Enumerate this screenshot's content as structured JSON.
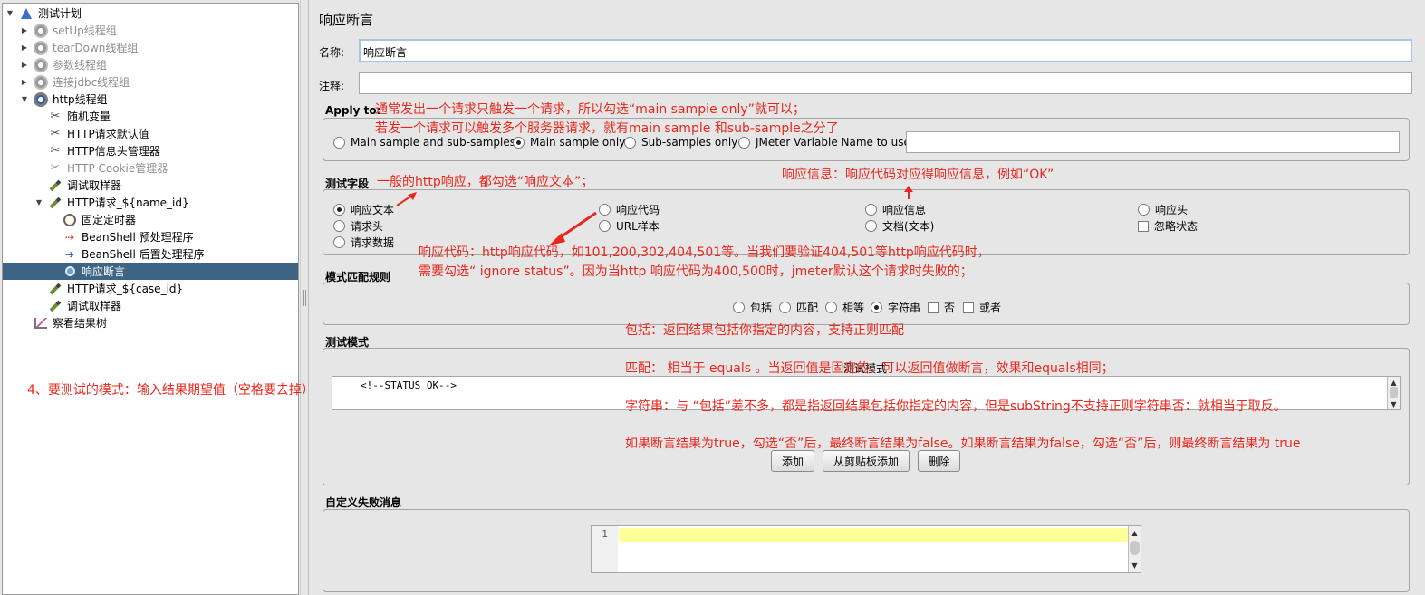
{
  "tree": {
    "items": [
      {
        "label": "测试计划"
      },
      {
        "label": "setUp线程组"
      },
      {
        "label": "tearDown线程组"
      },
      {
        "label": "参数线程组"
      },
      {
        "label": "连接jdbc线程组"
      },
      {
        "label": "http线程组"
      },
      {
        "label": "随机变量"
      },
      {
        "label": "HTTP请求默认值"
      },
      {
        "label": "HTTP信息头管理器"
      },
      {
        "label": "HTTP Cookie管理器"
      },
      {
        "label": "调试取样器"
      },
      {
        "label": "HTTP请求_${name_id}"
      },
      {
        "label": "固定定时器"
      },
      {
        "label": "BeanShell 预处理程序"
      },
      {
        "label": "BeanShell 后置处理程序"
      },
      {
        "label": "响应断言"
      },
      {
        "label": "HTTP请求_${case_id}"
      },
      {
        "label": "调试取样器"
      },
      {
        "label": "察看结果树"
      }
    ]
  },
  "panel": {
    "title": "响应断言",
    "name_label": "名称:",
    "name_value": "响应断言",
    "comment_label": "注释:",
    "comment_value": ""
  },
  "apply_to": {
    "title": "Apply to:",
    "options": [
      "Main sample and sub-samples",
      "Main sample only",
      "Sub-samples only",
      "JMeter Variable Name to use"
    ],
    "selected": "Main sample only",
    "variable_value": ""
  },
  "test_field": {
    "title": "测试字段",
    "options": [
      "响应文本",
      "响应代码",
      "响应信息",
      "响应头",
      "请求头",
      "URL样本",
      "文档(文本)",
      "忽略状态",
      "请求数据"
    ],
    "selected": "响应文本"
  },
  "pattern_rules": {
    "title": "模式匹配规则",
    "options": [
      "包括",
      "匹配",
      "相等",
      "字符串",
      "否",
      "或者"
    ],
    "selected": "字符串"
  },
  "test_patterns": {
    "title": "测试模式",
    "header": "测试模式",
    "value": "<!--STATUS OK-->",
    "buttons": {
      "add": "添加",
      "add_clipboard": "从剪贴板添加",
      "delete": "删除"
    }
  },
  "custom_failure": {
    "title": "自定义失败消息",
    "line_number": "1"
  },
  "annotations": {
    "apply_to_1": "通常发出一个请求只触发一个请求，所以勾选“main sampie only”就可以；",
    "apply_to_2": "若发一个请求可以触发多个服务器请求，就有main sample 和sub-sample之分了",
    "response_text": "一般的http响应，都勾选“响应文本”；",
    "response_message": "响应信息：响应代码对应得响应信息，例如“OK”",
    "response_code_1": "响应代码：http响应代码，如101,200,302,404,501等。当我们要验证404,501等http响应代码时，",
    "response_code_2": "需要勾选“ ignore status”。因为当http 响应代码为400,500时，jmeter默认这个请求时失败的；",
    "contains": "包括：返回结果包括你指定的内容，支持正则匹配",
    "matches": "匹配：  相当于 equals 。当返回值是固定的，可以返回值做断言，效果和equals相同；",
    "substring": "字符串：与 “包括”差不多，都是指返回结果包括你指定的内容，但是subString不支持正则字符串否：就相当于取反。",
    "negate": "如果断言结果为true，勾选“否”后，最终断言结果为false。如果断言结果为false，勾选“否”后，则最终断言结果为 true",
    "test_pattern_note": "4、要测试的模式：输入结果期望值（空格要去掉）"
  },
  "colors": {
    "annotation": "#e8281e",
    "selection": "#3e6483",
    "highlight_line": "#ffff99"
  }
}
